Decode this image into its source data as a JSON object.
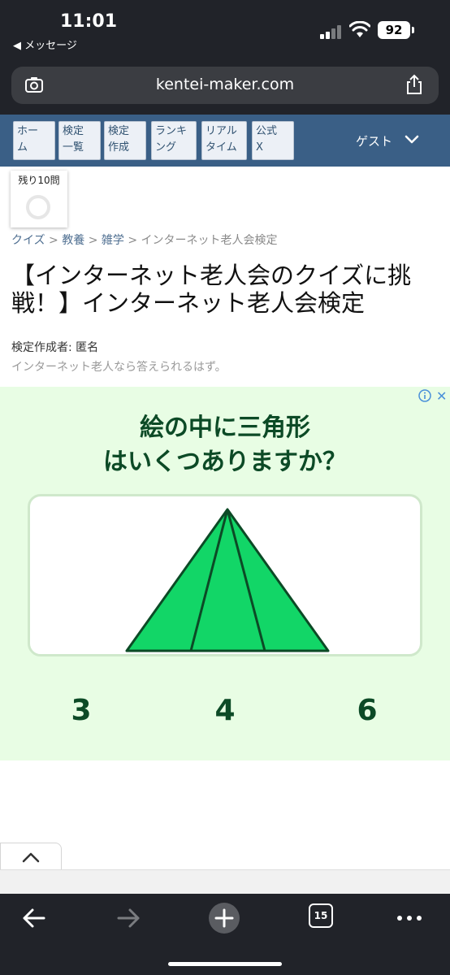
{
  "status_bar": {
    "time": "11:01",
    "back_app": "◀ メッセージ",
    "battery": "92"
  },
  "browser": {
    "url": "kentei-maker.com",
    "tab_count": "15"
  },
  "site_nav": {
    "items": [
      {
        "line1": "ホー",
        "line2": "ム"
      },
      {
        "line1": "検定",
        "line2": "一覧"
      },
      {
        "line1": "検定",
        "line2": "作成"
      },
      {
        "line1": "ランキ",
        "line2": "ング"
      },
      {
        "line1": "リアル",
        "line2": "タイム"
      },
      {
        "line1": "公式",
        "line2": "X"
      }
    ],
    "guest_label": "ゲスト"
  },
  "quiz": {
    "remaining": "残り10問",
    "breadcrumb": [
      "クイズ",
      "教養",
      "雑学",
      "インターネット老人会検定"
    ],
    "breadcrumb_separator": ">",
    "title": "【インターネット老人会のクイズに挑戦！】インターネット老人会検定",
    "author": "検定作成者: 匿名",
    "description": "インターネット老人なら答えられるはず。"
  },
  "ad": {
    "question_line1": "絵の中に三角形",
    "question_line2": "はいくつありますか？",
    "options": [
      "3",
      "4",
      "6"
    ],
    "triangle_fill": "#12d667",
    "text_color": "#0c4a26",
    "background": "#e8fde4"
  },
  "colors": {
    "nav_bar": "#3a5f86",
    "chrome": "#212329",
    "link": "#4f6f91"
  },
  "icons": [
    "camera-search-icon",
    "share-icon",
    "chevron-down-icon",
    "info-icon",
    "close-icon",
    "chevron-up-icon",
    "back-arrow-icon",
    "forward-arrow-icon",
    "new-tab-plus-icon",
    "tabs-icon",
    "more-icon"
  ]
}
